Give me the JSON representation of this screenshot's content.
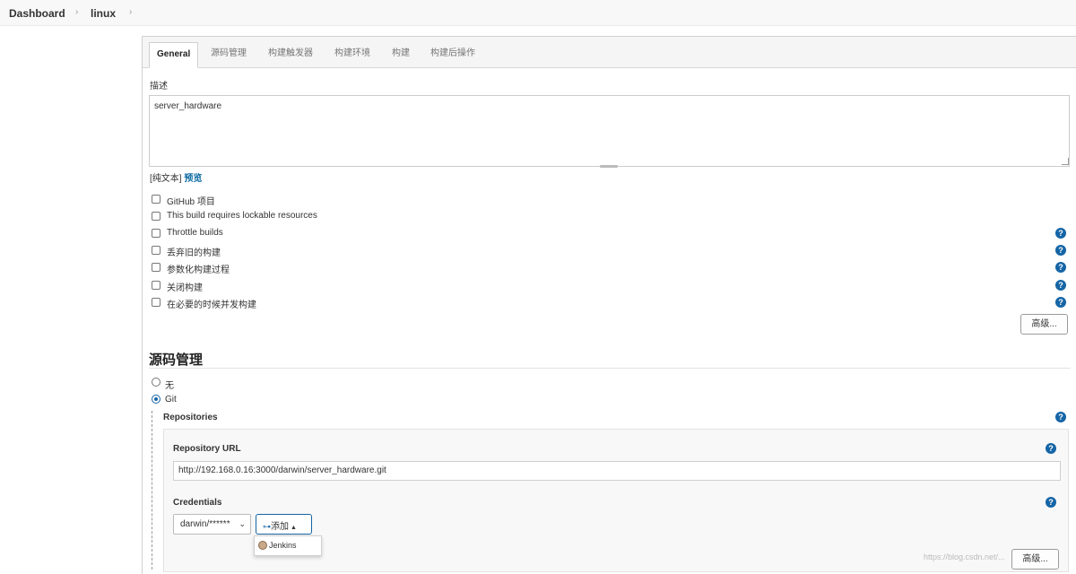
{
  "breadcrumb": {
    "items": [
      "Dashboard",
      "linux"
    ],
    "separator": "›"
  },
  "tabs": [
    "General",
    "源码管理",
    "构建触发器",
    "构建环境",
    "构建",
    "构建后操作"
  ],
  "general": {
    "description_label": "描述",
    "description_value": "server_hardware",
    "plain_text": "[纯文本]",
    "preview": "预览",
    "options": [
      {
        "label": "GitHub 项目",
        "checked": false,
        "help": false
      },
      {
        "label": "This build requires lockable resources",
        "checked": false,
        "help": false
      },
      {
        "label": "Throttle builds",
        "checked": false,
        "help": true
      },
      {
        "label": "丢弃旧的构建",
        "checked": false,
        "help": true
      },
      {
        "label": "参数化构建过程",
        "checked": false,
        "help": true
      },
      {
        "label": "关闭构建",
        "checked": false,
        "help": true
      },
      {
        "label": "在必要的时候并发构建",
        "checked": false,
        "help": true
      }
    ],
    "advanced_button": "高级..."
  },
  "scm": {
    "title": "源码管理",
    "radio_none": "无",
    "radio_git": "Git",
    "selected": "Git",
    "repositories_label": "Repositories",
    "repo_url_label": "Repository URL",
    "repo_url_value": "http://192.168.0.16:3000/darwin/server_hardware.git",
    "credentials_label": "Credentials",
    "credentials_selected": "darwin/******",
    "add_button": "添加",
    "add_dropdown": [
      "Jenkins"
    ],
    "advanced_button": "高级..."
  },
  "help_glyph": "?",
  "watermark": "https://blog.csdn.net/...",
  "colors": {
    "accent": "#1565a6",
    "link": "#0b6aa2"
  }
}
